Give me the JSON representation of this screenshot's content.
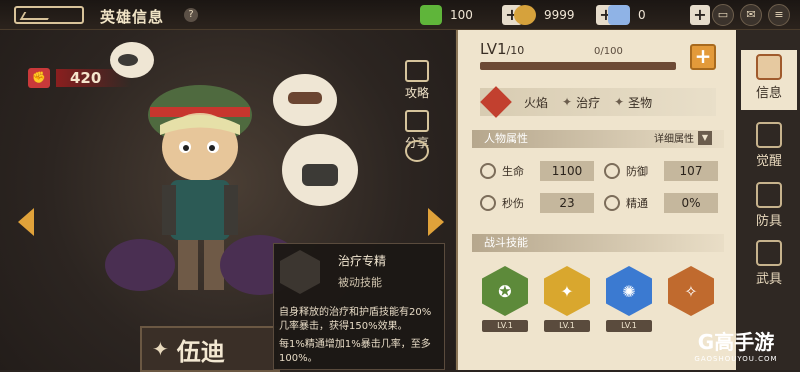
{
  "header": {
    "title": "英雄信息",
    "help_icon": "?"
  },
  "resources": [
    {
      "name": "green-gem",
      "value": "100",
      "color": "#5fb53a"
    },
    {
      "name": "gold-coin",
      "value": "9999",
      "color": "#d6a23c"
    },
    {
      "name": "crystal",
      "value": "0",
      "color": "#8fb3e6"
    }
  ],
  "topbar_buttons": [
    "chat-icon",
    "mail-icon",
    "menu-icon"
  ],
  "hero": {
    "power": "420",
    "name": "伍迪",
    "side_actions": [
      {
        "label": "攻略",
        "icon": "guide-icon"
      },
      {
        "label": "分享",
        "icon": "share-icon"
      },
      {
        "label": "",
        "icon": "heart-icon"
      }
    ]
  },
  "tooltip": {
    "skill_name": "治疗专精",
    "skill_type": "被动技能",
    "desc1": "自身释放的治疗和护盾技能有20%几率暴击，获得150%效果。",
    "desc2": "每1%精通增加1%暴击几率，至多100%。"
  },
  "panel": {
    "level_main": "LV1",
    "level_max": "/10",
    "exp_text": "0/100",
    "exp_fraction": 0,
    "elements": [
      {
        "label": "火焰",
        "dot": "✦"
      },
      {
        "label": "治疗",
        "dot": "✦"
      },
      {
        "label": "圣物",
        "dot": "✦"
      }
    ],
    "attr_header": "人物属性",
    "detail_link": "详细属性",
    "stats": [
      {
        "label": "生命",
        "value": "1100"
      },
      {
        "label": "防御",
        "value": "107"
      },
      {
        "label": "秒伤",
        "value": "23"
      },
      {
        "label": "精通",
        "value": "0%"
      }
    ],
    "skill_header": "战斗技能",
    "skills": [
      {
        "lv": "LV.1",
        "color": "#5d8a3a"
      },
      {
        "lv": "LV.1",
        "color": "#d9a72e"
      },
      {
        "lv": "LV.1",
        "color": "#3b7ad1"
      },
      {
        "lv": "",
        "color": "#c06a2e"
      }
    ]
  },
  "tabs": [
    {
      "label": "信息",
      "active": true
    },
    {
      "label": "觉醒",
      "active": false
    },
    {
      "label": "防具",
      "active": false
    },
    {
      "label": "武具",
      "active": false
    }
  ],
  "watermark": {
    "main": "G高手游",
    "sub": "GAOSHOUYOU.COM"
  }
}
